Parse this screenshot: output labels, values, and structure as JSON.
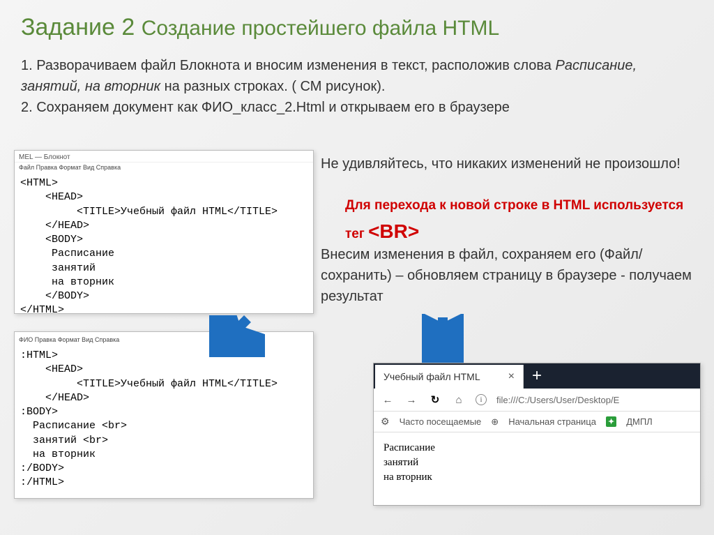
{
  "title": {
    "main": "Задание 2",
    "sub": "Создание простейшего файла HTML"
  },
  "intro": {
    "line1a": "1. Разворачиваем файл Блокнота и вносим изменения в текст, расположив слова ",
    "line1b_italic": "Расписание, занятий, на вторник",
    "line1c": " на разных строках. ( СМ рисунок).",
    "line2": "2. Сохраняем документ как ФИО_класс_2.Html и открываем его в браузере"
  },
  "notepad_common": {
    "titlebar": "MEL — Блокнот",
    "menubar": "Файл  Правка  Формат  Вид  Справка"
  },
  "notepad1_code": "<HTML>\n    <HEAD>\n         <TITLE>Учебный файл HTML</TITLE>\n    </HEAD>\n    <BODY>\n     Расписание\n     занятий\n     на вторник\n    </BODY>\n</HTML>",
  "notepad2_menubar": "ФИО  Правка  Формат  Вид  Справка",
  "notepad2_code": ":HTML>\n    <HEAD>\n         <TITLE>Учебный файл HTML</TITLE>\n    </HEAD>\n:BODY>\n  Расписание <br>\n  занятий <br>\n  на вторник\n:/BODY>\n:/HTML>",
  "right_text": "Не удивляйтесь, что никаких изменений не произошло!",
  "red_note_a": "Для перехода к новой строке в HTML используется тег ",
  "red_note_tag": "<BR>",
  "right_text2": "Внесим изменения в файл, сохраняем его (Файл/сохранить) – обновляем страницу в браузере - получаем результат",
  "browser": {
    "tab_title": "Учебный файл HTML",
    "tab_close": "×",
    "tab_plus": "+",
    "nav_back": "←",
    "nav_fwd": "→",
    "nav_reload": "↻",
    "nav_home": "⌂",
    "info_i": "i",
    "url": "file:///C:/Users/User/Desktop/E",
    "bookmarks_gear": "⚙",
    "bookmarks_freq": "Часто посещаемые",
    "bookmarks_globe": "⊕",
    "bookmarks_start": "Начальная страница",
    "bookmarks_green": "✦",
    "bookmarks_dmpl": "ДМПЛ",
    "content_l1": "Расписание",
    "content_l2": "занятий",
    "content_l3": "на вторник"
  }
}
